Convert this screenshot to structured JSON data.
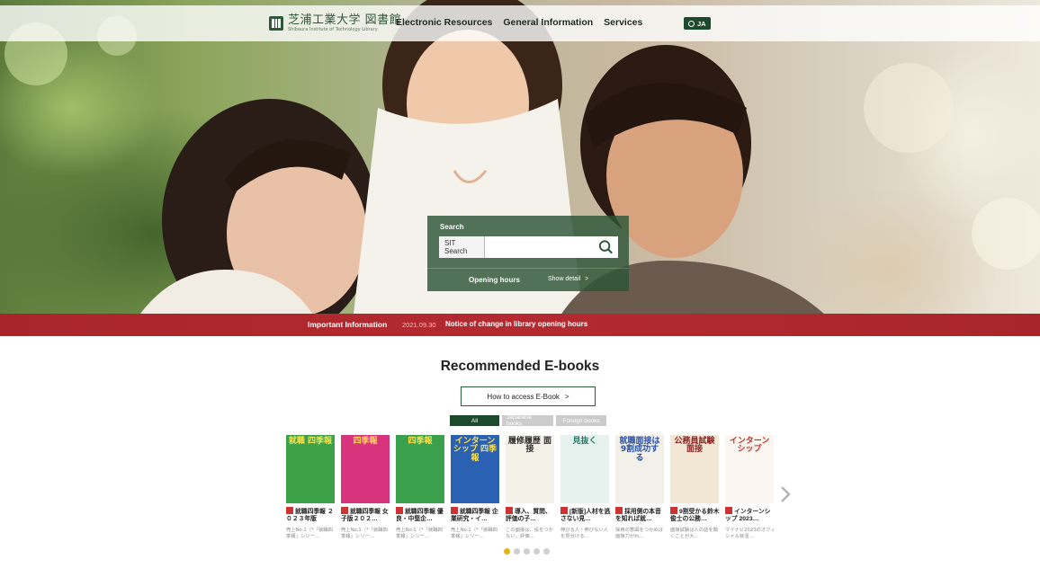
{
  "header": {
    "logo_jp": "芝浦工業大学 図書館",
    "logo_en": "Shibaura Institute of Technology Library",
    "nav": [
      "Electronic Resources",
      "General Information",
      "Services"
    ],
    "lang": "JA"
  },
  "search": {
    "label": "Search",
    "scope": "SIT Search",
    "value": "",
    "opening_label": "Opening hours",
    "show_detail": "Show detail",
    "chevron": ">"
  },
  "info": {
    "title": "Important Information",
    "date": "2021.09.30",
    "notice": "Notice of change in library opening hours"
  },
  "recommended": {
    "title": "Recommended E-books",
    "howto": "How to access E-Book",
    "howto_chevron": ">",
    "filters": [
      "All",
      "Japanese books",
      "Foreign books"
    ],
    "books": [
      {
        "title": "就職四季報 ２０２３年版",
        "desc": "売上No.1（*「就職四季報」シリー…",
        "cover_text": "就職 四季報",
        "bg": "#3da14a",
        "fg": "#ffe14a"
      },
      {
        "title": "就職四季報 女子版２０２…",
        "desc": "売上No.1（*「就職四季報」シリー…",
        "cover_text": "四季報",
        "bg": "#d8347d",
        "fg": "#ffe14a"
      },
      {
        "title": "就職四季報 優良・中堅企…",
        "desc": "売上No.1（*「就職四季報」シリー…",
        "cover_text": "四季報",
        "bg": "#3ba04b",
        "fg": "#ffe14a"
      },
      {
        "title": "就職四季報 企業研究・イ…",
        "desc": "売上No.1（*「就職四季報」シリー…",
        "cover_text": "インターンシップ 四季報",
        "bg": "#2b61b3",
        "fg": "#ffe14a"
      },
      {
        "title": "導入、質問、評価の子…",
        "desc": "この面接は、役をつかない。評価…",
        "cover_text": "履修履歴 面接",
        "bg": "#f4f1e8",
        "fg": "#2d2d2d"
      },
      {
        "title": "[新版]人材を逃さない見…",
        "desc": "伸びる人・伸びない人を見分ける…",
        "cover_text": "見抜く",
        "bg": "#e7f1ee",
        "fg": "#1e7a66"
      },
      {
        "title": "採用側の本音を知れば就…",
        "desc": "採用の意図をつかめば面接力がわ…",
        "cover_text": "就職面接は 9割成功する",
        "bg": "#f3f0ea",
        "fg": "#2a4fa1"
      },
      {
        "title": "9割受かる鈴木俊士の公務…",
        "desc": "面接試験は人の話を聞くことが大…",
        "cover_text": "公務員試験 面接",
        "bg": "#f2e6d4",
        "fg": "#8a1f1f"
      },
      {
        "title": "インターンシップ 2023…",
        "desc": "マイナビ2023のオフィシャル就活…",
        "cover_text": "インターンシップ",
        "bg": "#fbf6ef",
        "fg": "#c9302c"
      }
    ],
    "page_count": 5,
    "active_page": 1
  },
  "colors": {
    "brand_green": "#1d4a2c",
    "info_red": "#b32a30",
    "dot_active": "#e0b21e"
  },
  "icons": {
    "search": "search-icon",
    "next": "chevron-right-icon",
    "globe": "globe-icon",
    "logo": "library-logo-icon"
  }
}
